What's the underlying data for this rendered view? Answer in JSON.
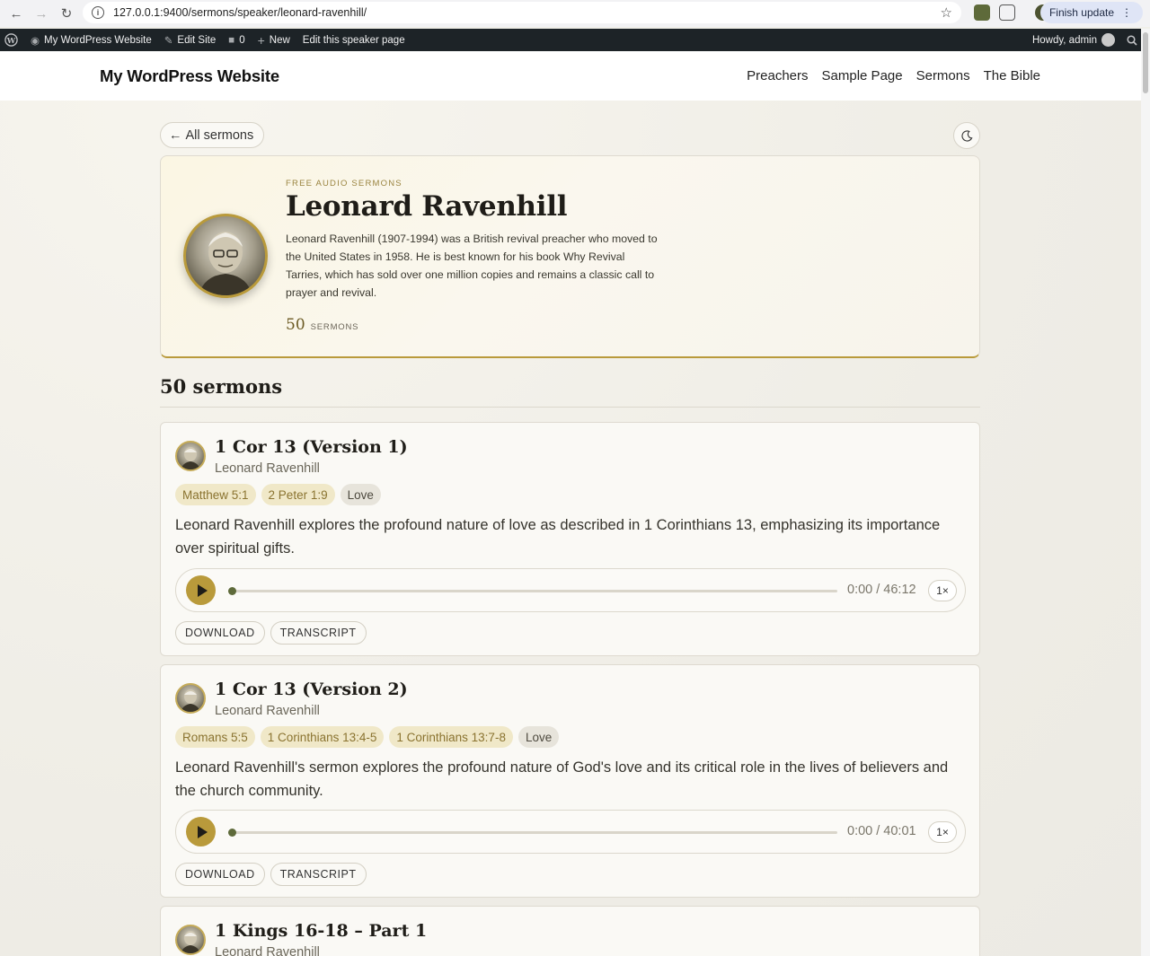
{
  "browser": {
    "url": "127.0.0.1:9400/sermons/speaker/leonard-ravenhill/",
    "finish_update": "Finish update"
  },
  "admin_bar": {
    "site_name": "My WordPress Website",
    "edit_site": "Edit Site",
    "comments_count": "0",
    "new_label": "New",
    "edit_page": "Edit this speaker page",
    "howdy": "Howdy, admin"
  },
  "site": {
    "title": "My WordPress Website",
    "nav": [
      "Preachers",
      "Sample Page",
      "Sermons",
      "The Bible"
    ]
  },
  "page": {
    "back_label": "All sermons",
    "hero": {
      "eyebrow": "FREE AUDIO SERMONS",
      "name": "Leonard Ravenhill",
      "bio": "Leonard Ravenhill (1907-1994) was a British revival preacher who moved to the United States in 1958. He is best known for his book Why Revival Tarries, which has sold over one million copies and remains a classic call to prayer and revival.",
      "count": "50",
      "count_label": "SERMONS"
    },
    "list_heading": "50 sermons",
    "sermons": [
      {
        "title": "1 Cor 13 (Version 1)",
        "speaker": "Leonard Ravenhill",
        "scripture_tags": [
          "Matthew 5:1",
          "2 Peter 1:9"
        ],
        "topic_tags": [
          "Love"
        ],
        "description": "Leonard Ravenhill explores the profound nature of love as described in 1 Corinthians 13, emphasizing its importance over spiritual gifts.",
        "time": "0:00 / 46:12",
        "speed": "1×",
        "download": "DOWNLOAD",
        "transcript": "TRANSCRIPT"
      },
      {
        "title": "1 Cor 13 (Version 2)",
        "speaker": "Leonard Ravenhill",
        "scripture_tags": [
          "Romans 5:5",
          "1 Corinthians 13:4-5",
          "1 Corinthians 13:7-8"
        ],
        "topic_tags": [
          "Love"
        ],
        "description": "Leonard Ravenhill's sermon explores the profound nature of God's love and its critical role in the lives of believers and the church community.",
        "time": "0:00 / 40:01",
        "speed": "1×",
        "download": "DOWNLOAD",
        "transcript": "TRANSCRIPT"
      },
      {
        "title": "1 Kings 16-18 – Part 1",
        "speaker": "Leonard Ravenhill"
      }
    ]
  }
}
